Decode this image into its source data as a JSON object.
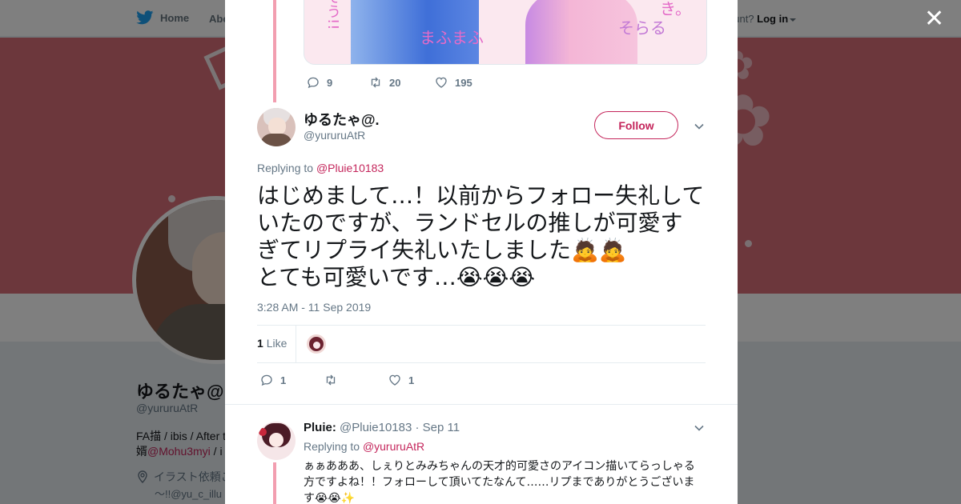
{
  "nav": {
    "home_label": "Home",
    "about_label": "Abo",
    "account_prompt": "ccount?",
    "login_label": "Log in"
  },
  "profile": {
    "name": "ゆるたゃ@.",
    "handle": "@yururuAtR",
    "bio_line1": "FA描 / ibis / After t",
    "bio_line2_prefix": "婿",
    "bio_link": "@Mohu3myi",
    "bio_line2_suffix": " / i",
    "location_line1": "イラスト依頼こ",
    "location_line2": "～!!@yu_c_illu"
  },
  "colors": {
    "accent": "#c4255b",
    "banner": "#d86f78",
    "thread_line": "#f29eb0",
    "muted": "#657786"
  },
  "modal": {
    "close_icon": "close-icon",
    "prev_tweet": {
      "media_text_left_vertical": "そう!!",
      "media_text_mid": "まふまふ",
      "media_text_right": "そらる",
      "media_text_corner": "き。",
      "reply_count": "9",
      "retweet_count": "20",
      "like_count": "195"
    },
    "focused_tweet": {
      "name": "ゆるたゃ@.",
      "handle": "@yururuAtR",
      "follow_label": "Follow",
      "replying_label": "Replying to",
      "replying_to": "@Pluie10183",
      "text_line1": "はじめまして…！以前からフォロー失礼して",
      "text_line2": "いたのですが、ランドセルの推しが可愛す",
      "text_line3": "ぎてリプライ失礼いたしました🙇🙇",
      "text_line4": "とても可愛いです…😭😭😭",
      "timestamp": "3:28 AM - 11 Sep 2019",
      "like_count": "1",
      "like_label": "Like",
      "reply_count": "1",
      "retweet_count": "",
      "fav_count": "1"
    },
    "reply_tweet": {
      "name": "Pluie:",
      "handle": "@Pluie10183",
      "date": "· Sep 11",
      "replying_label": "Replying to",
      "replying_to": "@yururuAtR",
      "text_line1": "ぁぁあああ、しぇりとみみちゃんの天才的可愛さのアイコン描いてらっしゃる",
      "text_line2": "方ですよね！！フォローして頂いてたなんて……リプまでありがとうございま",
      "text_line3": "す😭😭✨"
    }
  }
}
